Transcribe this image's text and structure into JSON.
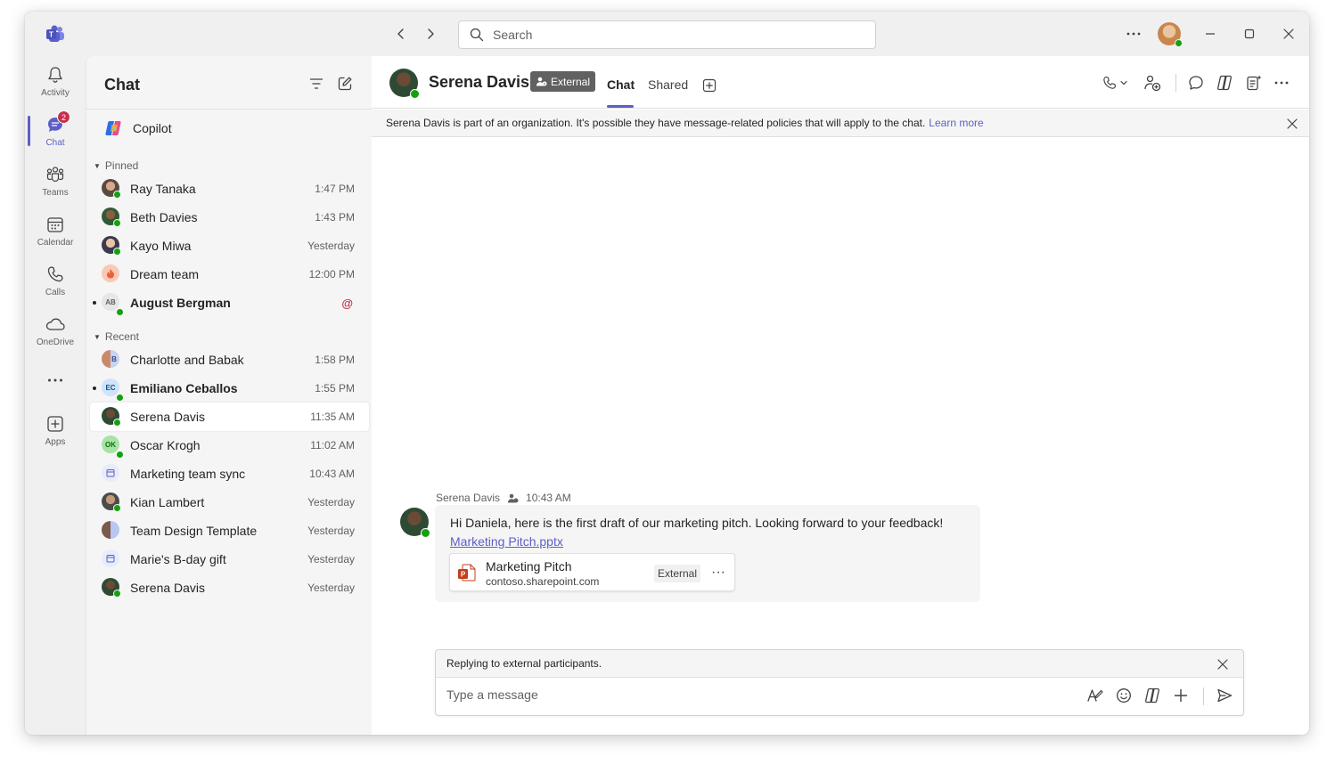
{
  "search": {
    "placeholder": "Search"
  },
  "rail": [
    {
      "label": "Activity",
      "icon": "bell-icon"
    },
    {
      "label": "Chat",
      "icon": "chat-icon",
      "badge": "2"
    },
    {
      "label": "Teams",
      "icon": "teams-icon"
    },
    {
      "label": "Calendar",
      "icon": "calendar-icon"
    },
    {
      "label": "Calls",
      "icon": "phone-icon"
    },
    {
      "label": "OneDrive",
      "icon": "cloud-icon"
    },
    {
      "label": "",
      "icon": "more-icon"
    },
    {
      "label": "Apps",
      "icon": "add-app-icon"
    }
  ],
  "chatlist": {
    "title": "Chat",
    "copilot": "Copilot",
    "pinned_label": "Pinned",
    "recent_label": "Recent",
    "pinned": [
      {
        "name": "Ray Tanaka",
        "time": "1:47 PM"
      },
      {
        "name": "Beth Davies",
        "time": "1:43 PM"
      },
      {
        "name": "Kayo Miwa",
        "time": "Yesterday"
      },
      {
        "name": "Dream team",
        "time": "12:00 PM"
      },
      {
        "name": "August Bergman",
        "initials": "AB",
        "mention": "@"
      }
    ],
    "recent": [
      {
        "name": "Charlotte and Babak",
        "initials": "B",
        "time": "1:58 PM"
      },
      {
        "name": "Emiliano Ceballos",
        "initials": "EC",
        "time": "1:55 PM"
      },
      {
        "name": "Serena Davis",
        "time": "11:35 AM"
      },
      {
        "name": "Oscar Krogh",
        "initials": "OK",
        "time": "11:02 AM"
      },
      {
        "name": "Marketing team sync",
        "time": "10:43 AM"
      },
      {
        "name": "Kian Lambert",
        "time": "Yesterday"
      },
      {
        "name": "Team Design Template",
        "time": "Yesterday"
      },
      {
        "name": "Marie's B-day gift",
        "time": "Yesterday"
      },
      {
        "name": "Serena Davis",
        "time": "Yesterday"
      }
    ]
  },
  "header": {
    "name": "Serena Davis",
    "badge": "External",
    "tabs": [
      "Chat",
      "Shared"
    ]
  },
  "banner": {
    "text": "Serena Davis is part of an organization. It's possible they have message-related policies that will apply to the chat.",
    "link": "Learn more"
  },
  "message": {
    "sender": "Serena Davis",
    "time": "10:43 AM",
    "text": "Hi Daniela,  here is the first draft of our marketing pitch. Looking forward to your feedback!",
    "link": "Marketing Pitch.pptx",
    "file": {
      "name": "Marketing Pitch",
      "url": "contoso.sharepoint.com",
      "badge": "External",
      "more": "···"
    }
  },
  "compose": {
    "note": "Replying to external participants.",
    "placeholder": "Type a message"
  },
  "colors": {
    "brand": "#5b5fc7",
    "presence": "#13a10e",
    "badge": "#c4314b"
  }
}
